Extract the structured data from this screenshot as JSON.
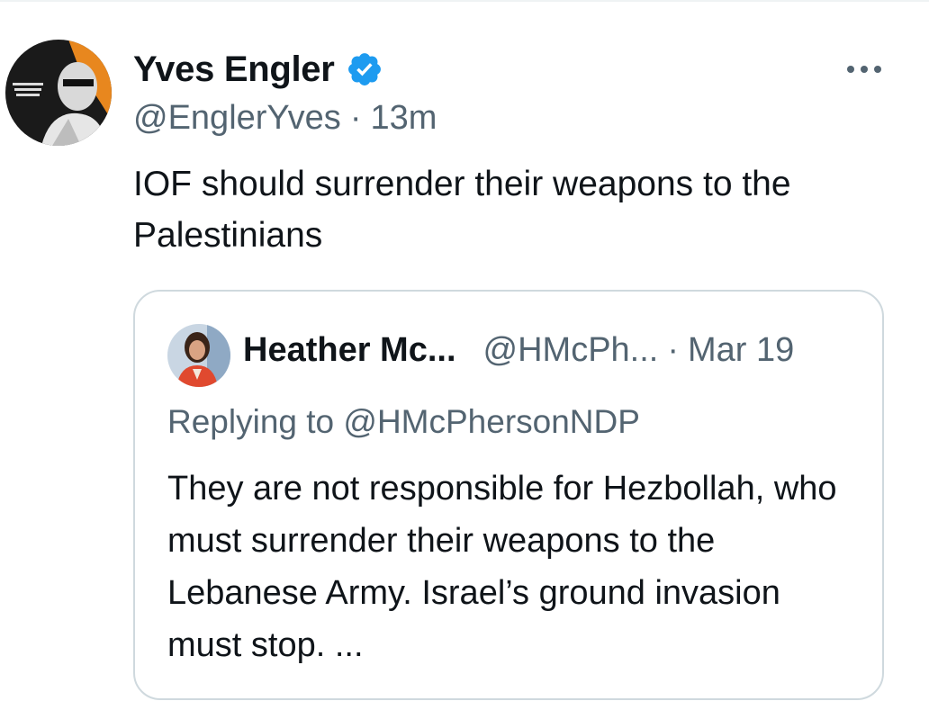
{
  "tweet": {
    "author_name": "Yves Engler",
    "handle": "@EnglerYves",
    "separator": "·",
    "time": "13m",
    "text": "IOF should surrender their weapons to the Palestinians",
    "avatar_icon": "profile-photo-icon",
    "verified_icon": "verified-badge-icon",
    "more_icon": "more-options-icon"
  },
  "quote": {
    "author_name": "Heather Mc...",
    "handle": "@HMcPh...",
    "separator": "·",
    "date": "Mar 19",
    "replying_to": "Replying to @HMcPhersonNDP",
    "text": "They are not responsible for Hezbollah, who must surrender their weapons to the Lebanese Army. Israel’s ground invasion must stop. ..."
  },
  "colors": {
    "primary_text": "#0f1419",
    "secondary_text": "#536471",
    "verified_blue": "#1d9bf0",
    "border": "#cfd9de"
  }
}
